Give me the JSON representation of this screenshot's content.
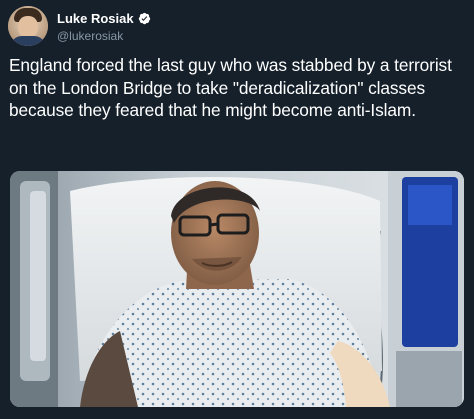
{
  "user": {
    "display_name": "Luke Rosiak",
    "handle": "@lukerosiak",
    "verified": true
  },
  "tweet": {
    "text": "England forced the last guy who was stabbed by a terrorist on the London Bridge to take \"deradicalization\" classes because they feared that he might become anti-Islam."
  },
  "icons": {
    "verified": "verified-badge-icon",
    "avatar": "user-avatar"
  },
  "colors": {
    "background": "#15202b",
    "text_primary": "#ffffff",
    "text_secondary": "#8899a6",
    "verified": "#ffffff"
  }
}
